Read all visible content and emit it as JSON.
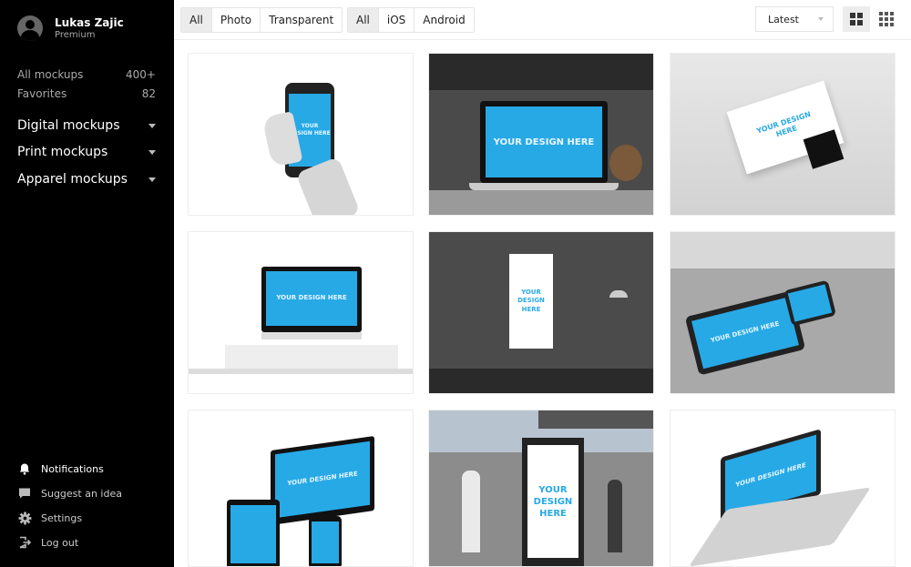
{
  "user": {
    "name": "Lukas Zajic",
    "plan": "Premium"
  },
  "sidebar": {
    "counts": [
      {
        "label": "All mockups",
        "count": "400+"
      },
      {
        "label": "Favorites",
        "count": "82"
      }
    ],
    "categories": [
      {
        "label": "Digital mockups"
      },
      {
        "label": "Print mockups"
      },
      {
        "label": "Apparel mockups"
      }
    ],
    "bottom": [
      {
        "label": "Notifications",
        "icon": "bell-icon"
      },
      {
        "label": "Suggest an idea",
        "icon": "chat-icon"
      },
      {
        "label": "Settings",
        "icon": "gear-icon"
      },
      {
        "label": "Log out",
        "icon": "logout-icon"
      }
    ]
  },
  "filters": {
    "type": [
      "All",
      "Photo",
      "Transparent"
    ],
    "platform": [
      "All",
      "iOS",
      "Android"
    ],
    "type_selected": "All",
    "platform_selected": "All"
  },
  "sort": {
    "value": "Latest"
  },
  "view_modes": [
    "grid-large-icon",
    "grid-small-icon"
  ],
  "mockup_text": "YOUR DESIGN HERE",
  "mockups": [
    {
      "device": "iphone-in-hand"
    },
    {
      "device": "macbook-desk"
    },
    {
      "device": "business-card-clip"
    },
    {
      "device": "imac-desk"
    },
    {
      "device": "poster-wall"
    },
    {
      "device": "ipad-iphone-couch"
    },
    {
      "device": "multi-device"
    },
    {
      "device": "bus-stop-billboard"
    },
    {
      "device": "macbook-gold"
    }
  ],
  "colors": {
    "accent": "#27a9e6",
    "sidebar": "#000000"
  }
}
